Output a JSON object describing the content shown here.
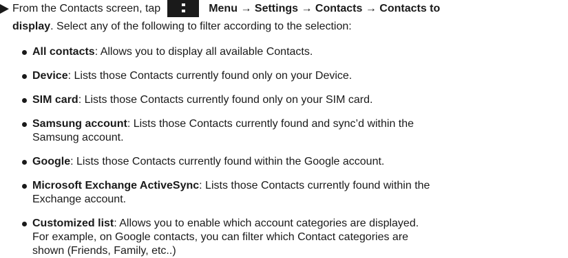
{
  "intro": {
    "prefix": "From the Contacts screen, tap",
    "menu_label": "Menu",
    "arrow_1": "→",
    "settings_label": "Settings",
    "arrow_2": "→",
    "contacts_label": "Contacts",
    "arrow_3": "→",
    "contacts_to_label": "Contacts to",
    "display_label": "display",
    "suffix": ". Select any of the following to filter according to the selection:"
  },
  "items": [
    {
      "term": "All contacts",
      "lines": [
        ": Allows you to display all available Contacts."
      ]
    },
    {
      "term": "Device",
      "lines": [
        ": Lists those Contacts currently found only on your Device."
      ]
    },
    {
      "term": "SIM card",
      "lines": [
        ": Lists those Contacts currently found only on your SIM card."
      ]
    },
    {
      "term": "Samsung account",
      "lines": [
        ": Lists those Contacts currently found and sync’d within the",
        "Samsung account."
      ]
    },
    {
      "term": "Google",
      "lines": [
        ": Lists those Contacts currently found within the Google account."
      ]
    },
    {
      "term": "Microsoft Exchange ActiveSync",
      "lines": [
        ": Lists those Contacts currently found within the",
        "Exchange account."
      ]
    },
    {
      "term": "Customized list",
      "lines": [
        ": Allows you to enable which account categories are displayed.",
        "For example, on Google contacts, you can filter which Contact categories are",
        "shown (Friends, Family, etc..)"
      ]
    }
  ]
}
